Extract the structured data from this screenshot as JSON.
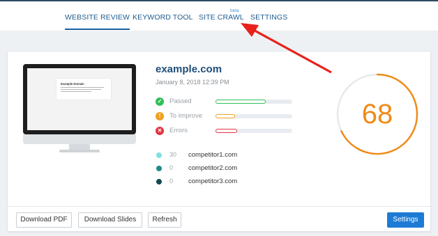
{
  "nav": {
    "website_review": "WEBSITE REVIEW",
    "keyword_tool": "KEYWORD TOOL",
    "site_crawl": "SITE CRAWL",
    "beta": "beta",
    "settings": "SETTINGS"
  },
  "preview": {
    "title": "Example Domain"
  },
  "review": {
    "domain": "example.com",
    "date": "January 8, 2018 12:39 PM",
    "stats": [
      {
        "label": "Passed",
        "color": "#2fbf5a",
        "fraction": 0.65,
        "icon": "check-icon",
        "glyph": "✓"
      },
      {
        "label": "To Improve",
        "color": "#f0a020",
        "fraction": 0.25,
        "icon": "exclamation-icon",
        "glyph": "!"
      },
      {
        "label": "Errors",
        "color": "#e3343f",
        "fraction": 0.28,
        "icon": "x-icon",
        "glyph": "✕"
      }
    ],
    "competitors": [
      {
        "count": "30",
        "name": "competitor1.com",
        "color": "#7fe0e0"
      },
      {
        "count": "0",
        "name": "competitor2.com",
        "color": "#1f8a8a"
      },
      {
        "count": "0",
        "name": "competitor3.com",
        "color": "#124a52"
      }
    ]
  },
  "score": {
    "value": "68",
    "fraction": 0.68,
    "color": "#f08a16",
    "track_color": "#e6e9ec"
  },
  "footer": {
    "download_pdf": "Download PDF",
    "download_slides": "Download Slides",
    "refresh": "Refresh",
    "settings": "Settings"
  },
  "colors": {
    "accent": "#1d7bd6",
    "annotation_arrow": "#e8211b"
  }
}
